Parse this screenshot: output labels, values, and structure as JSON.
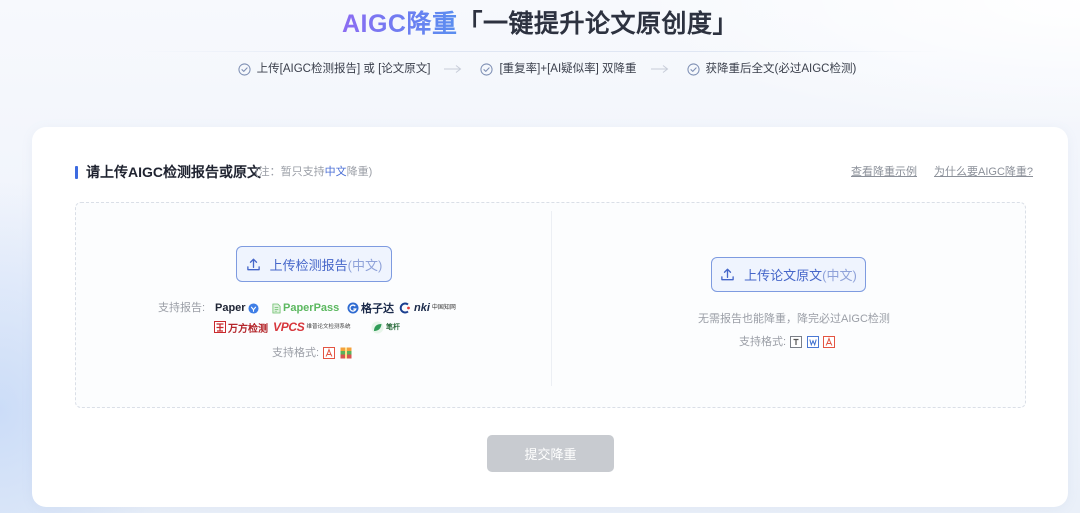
{
  "header": {
    "title_highlight": "AIGC降重",
    "title_rest": "「一键提升论文原创度」",
    "steps": [
      {
        "label": "上传[AIGC检测报告] 或 [论文原文]",
        "icon": "check-circle-icon"
      },
      {
        "label": "[重复率]+[AI疑似率] 双降重",
        "icon": "check-circle-icon"
      },
      {
        "label": "获降重后全文(必过AIGC检测)",
        "icon": "check-circle-icon"
      }
    ],
    "step_separator_icon": "arrow-right-icon"
  },
  "upload_card": {
    "title": "请上传AIGC检测报告或原文",
    "note": {
      "prefix": "(注：暂只支持",
      "highlight": "中文",
      "suffix": "降重)"
    },
    "links": {
      "example": "查看降重示例",
      "why": "为什么要AIGC降重?"
    },
    "report_upload": {
      "button_label": "上传检测报告",
      "button_hint": "(中文)",
      "button_icon": "upload-icon",
      "supported_reports_label": "支持报告:",
      "supported_reports": [
        {
          "name": "Paper",
          "icon": "paperyy-logo"
        },
        {
          "name": "PaperPass",
          "icon": "paperpass-logo"
        },
        {
          "name": "格子达",
          "icon": "gezida-logo"
        },
        {
          "name": "nki",
          "sub": "中国知网",
          "icon": "cnki-logo"
        },
        {
          "name": "万方检测",
          "icon": "wanfang-logo"
        },
        {
          "name": "VPCS",
          "sub": "维普论文检测系统",
          "icon": "vpcs-logo"
        },
        {
          "name": "笔杆",
          "icon": "bigan-logo"
        }
      ],
      "supported_formats_label": "支持格式:",
      "supported_formats": [
        "pdf-icon",
        "zip-icon"
      ]
    },
    "original_upload": {
      "button_label": "上传论文原文",
      "button_hint": "(中文)",
      "button_icon": "upload-icon",
      "description": "无需报告也能降重，降完必过AIGC检测",
      "supported_formats_label": "支持格式:",
      "supported_formats": [
        "txt-icon",
        "word-icon",
        "pdf-icon"
      ]
    },
    "submit": {
      "label": "提交降重",
      "disabled": true
    }
  },
  "colors": {
    "title_highlight_start": "#8c6cf2",
    "title_highlight_end": "#5a8ff0",
    "accent_blue": "#4566c9",
    "upload_button_bg": "#eff4fe",
    "submit_disabled_bg": "#c8cbd0",
    "text_dark": "#1f2330",
    "text_muted": "#9a9ea6"
  }
}
